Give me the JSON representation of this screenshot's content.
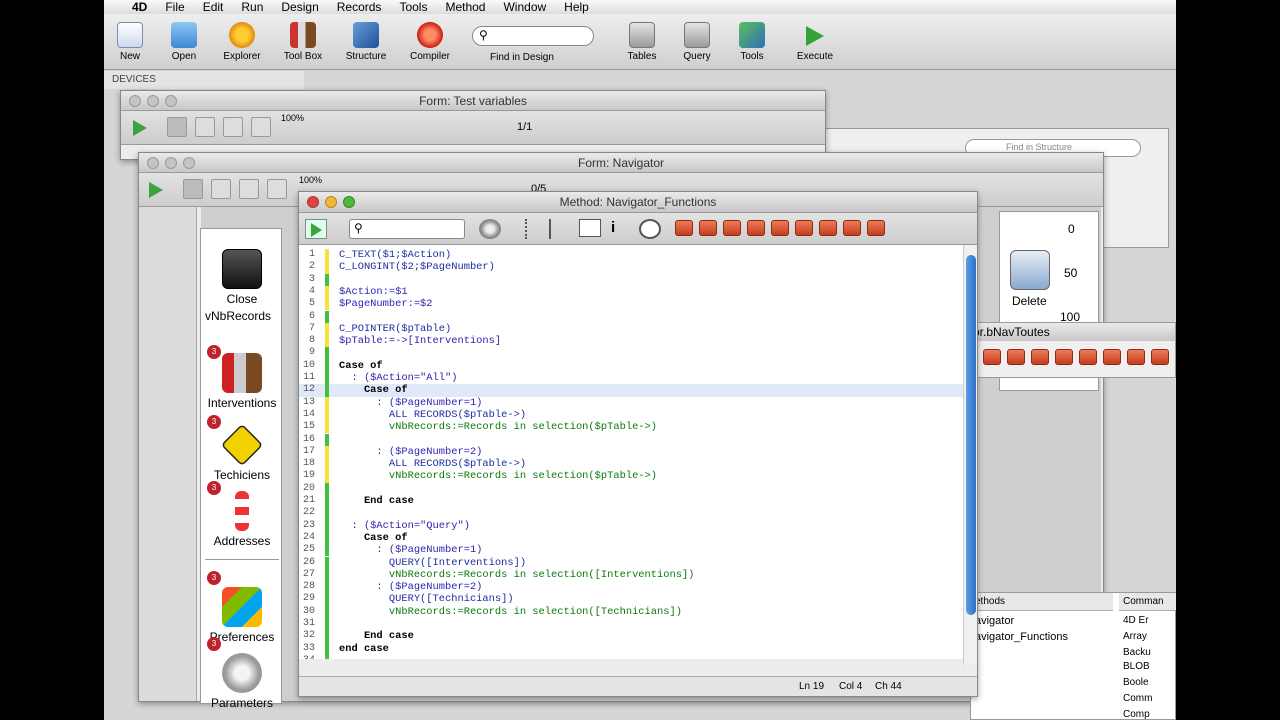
{
  "menu": {
    "app": "4D",
    "items": [
      "File",
      "Edit",
      "Run",
      "Design",
      "Records",
      "Tools",
      "Method",
      "Window",
      "Help"
    ]
  },
  "toolbar": {
    "buttons": [
      {
        "label": "New",
        "icon": "new-document-icon"
      },
      {
        "label": "Open",
        "icon": "folder-icon"
      },
      {
        "label": "Explorer",
        "icon": "gear-icon"
      },
      {
        "label": "Tool Box",
        "icon": "toolbox-icon"
      },
      {
        "label": "Structure",
        "icon": "structure-icon"
      },
      {
        "label": "Compiler",
        "icon": "compiler-icon"
      },
      {
        "label": "Tables",
        "icon": "tables-icon"
      },
      {
        "label": "Query",
        "icon": "query-icon"
      },
      {
        "label": "Tools",
        "icon": "tools-icon"
      },
      {
        "label": "Execute",
        "icon": "play-icon"
      }
    ],
    "find_label": "Find in Design"
  },
  "devices": "DEVICES",
  "win_test": {
    "title": "Form: Test variables",
    "zoom": "100%",
    "page": "1/1"
  },
  "win_nav": {
    "title": "Form: Navigator",
    "zoom": "100%",
    "page": "0/5"
  },
  "structure_find": "Find in Structure",
  "ruler": [
    "0",
    "50",
    "100"
  ],
  "form": {
    "close": "Close",
    "delete": "Delete",
    "variable": "vNbRecords",
    "items": [
      "Interventions",
      "Techiciens",
      "Addresses",
      "Preferences",
      "Parameters"
    ],
    "badges": [
      "3",
      "3",
      "3",
      "3",
      "3"
    ]
  },
  "bnav_title": "or.bNavToutes",
  "methods_header": "ethods",
  "methods": [
    "avigator",
    "avigator_Functions"
  ],
  "commands_header": "Comman",
  "commands": [
    "4D Er",
    "Array",
    "Backu",
    "BLOB",
    "Boole",
    "Comm",
    "Comp"
  ],
  "editor": {
    "title": "Method: Navigator_Functions",
    "status": {
      "ln": "Ln 19",
      "col": "Col 4",
      "ch": "Ch 44"
    }
  },
  "code": [
    "C_TEXT($1;$Action)",
    "C_LONGINT($2;$PageNumber)",
    "",
    "$Action:=$1",
    "$PageNumber:=$2",
    "",
    "C_POINTER($pTable)",
    "$pTable:=->[Interventions]",
    "",
    "Case of",
    "  : ($Action=\"All\")",
    "    Case of",
    "      : ($PageNumber=1)",
    "        ALL RECORDS($pTable->)",
    "        vNbRecords:=Records in selection($pTable->)",
    "",
    "      : ($PageNumber=2)",
    "        ALL RECORDS($pTable->)",
    "        vNbRecords:=Records in selection($pTable->)",
    "",
    "    End case",
    "",
    "  : ($Action=\"Query\")",
    "    Case of",
    "      : ($PageNumber=1)",
    "        QUERY([Interventions])",
    "        vNbRecords:=Records in selection([Interventions])",
    "      : ($PageNumber=2)",
    "        QUERY([Technicians])",
    "        vNbRecords:=Records in selection([Technicians])",
    "",
    "    End case",
    "end case",
    ""
  ]
}
